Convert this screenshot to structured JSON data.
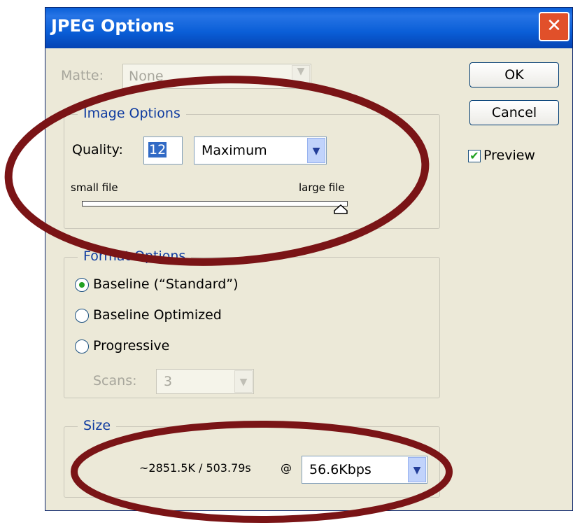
{
  "title": "JPEG Options",
  "matte": {
    "label": "Matte:",
    "value": "None"
  },
  "buttons": {
    "ok": "OK",
    "cancel": "Cancel"
  },
  "preview": {
    "label": "Preview",
    "checked": true
  },
  "image_options": {
    "legend": "Image Options",
    "quality_label": "Quality:",
    "quality_value": "12",
    "quality_preset": "Maximum",
    "slider_min_label": "small file",
    "slider_max_label": "large file",
    "slider_fraction": 1.0
  },
  "format_options": {
    "legend": "Format Options",
    "options": [
      "Baseline (“Standard”)",
      "Baseline Optimized",
      "Progressive"
    ],
    "selected_index": 0,
    "scans_label": "Scans:",
    "scans_value": "3"
  },
  "size": {
    "legend": "Size",
    "estimate": "~2851.5K / 503.79s",
    "at": "@",
    "speed": "56.6Kbps"
  },
  "colors": {
    "annotation": "#7a1416",
    "title_bar": "#0a5ed7",
    "legend_text": "#0f3ba0"
  }
}
